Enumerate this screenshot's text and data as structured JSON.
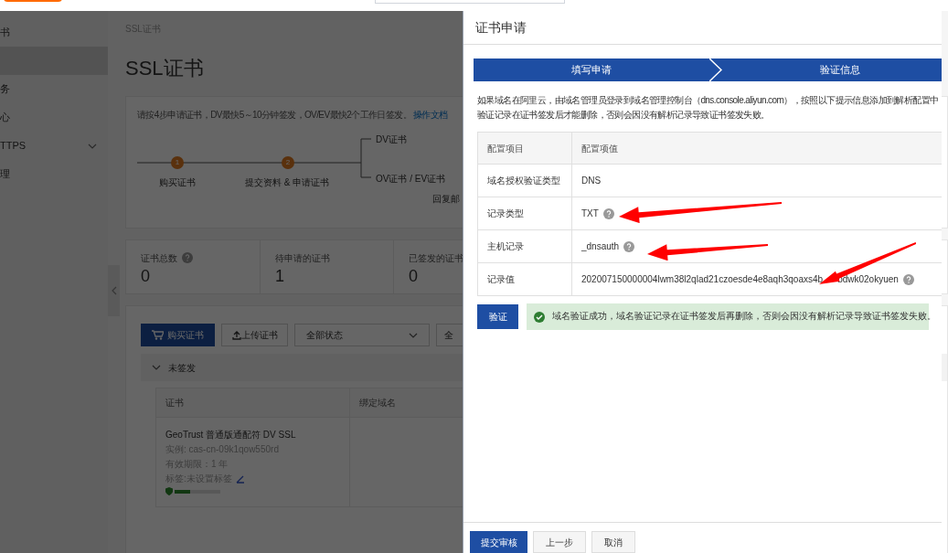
{
  "sidebar": {
    "items": [
      {
        "label": "书",
        "selected": false
      },
      {
        "selected": true
      },
      {
        "label": "务",
        "selected": false
      },
      {
        "label": "心",
        "selected": false
      },
      {
        "label": "TTPS",
        "selected": false,
        "expandable": true
      },
      {
        "label": "理",
        "selected": false
      }
    ]
  },
  "page": {
    "breadcrumb": "SSL证书",
    "title": "SSL证书",
    "guide": {
      "hint": "请按4步申请证书，DV最快5～10分钟签发，OV/EV最快2个工作日签发。",
      "link": "操作文档",
      "steps": [
        {
          "number": "1",
          "label": "购买证书"
        },
        {
          "number": "2",
          "label": "提交资料 & 申请证书"
        }
      ],
      "branches": [
        "DV证书",
        "OV证书 / EV证书"
      ],
      "branch_note": "回复邮"
    },
    "stats": [
      {
        "label": "证书总数",
        "help": true,
        "value": "0"
      },
      {
        "label": "待申请的证书",
        "help": false,
        "value": "1"
      },
      {
        "label": "已签发的证书",
        "value": "0"
      }
    ],
    "toolbar": {
      "buy": "购买证书",
      "upload": "上传证书",
      "status_select": "全部状态",
      "select_2": "全"
    },
    "section": {
      "title": "未签发",
      "expanded": true,
      "columns": [
        "证书",
        "绑定域名"
      ],
      "rows": [
        {
          "name": "GeoTrust 普通版通配符 DV SSL",
          "instance": "实例: cas-cn-09k1qow550rd",
          "validity": "有效期限：1 年",
          "tags": "标签:未设置标签",
          "level": 0.33
        }
      ]
    }
  },
  "drawer": {
    "title": "证书申请",
    "steps": [
      "填写申请",
      "验证信息"
    ],
    "description": [
      "如果域名在阿里云，由域名管理员登录到域名管理控制台（dns.console.aliyun.com），按照以下提示信息添加到解析配置中",
      "验证记录在证书签发后才能删除，否则会因没有解析记录导致证书签发失败。"
    ],
    "table": {
      "columns": [
        "配置项目",
        "配置项值"
      ],
      "rows": [
        {
          "item": "域名授权验证类型",
          "value": "DNS",
          "help": false
        },
        {
          "item": "记录类型",
          "value": "TXT",
          "help": true
        },
        {
          "item": "主机记录",
          "value": "_dnsauth",
          "help": true
        },
        {
          "item": "记录值",
          "value": "202007150000004lwm38l2qlad21czoesde4e8aqh3qoaxs4b",
          "value_tail": "bdwk02okyuen",
          "help": true
        }
      ]
    },
    "verify_button": "验证",
    "message": {
      "kind": "success",
      "text": "域名验证成功，域名验证记录在证书签发后再删除，否则会因没有解析记录导致证书签发失败。"
    },
    "footer": [
      "提交审核",
      "上一步",
      "取消"
    ]
  }
}
